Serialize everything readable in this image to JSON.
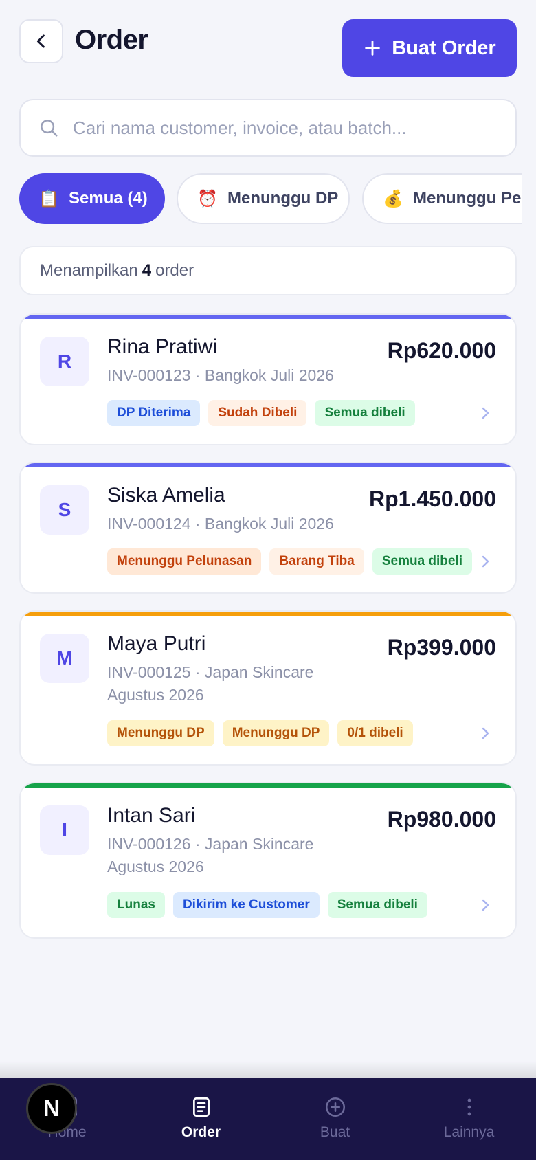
{
  "header": {
    "title": "Order",
    "create_label": "Buat Order"
  },
  "search": {
    "placeholder": "Cari nama customer, invoice, atau batch..."
  },
  "filters": [
    {
      "emoji": "📋",
      "label": "Semua (4)",
      "active": true
    },
    {
      "emoji": "⏰",
      "label": "Menunggu DP",
      "active": false
    },
    {
      "emoji": "💰",
      "label": "Menunggu Pelunasan",
      "active": false
    }
  ],
  "summary": {
    "prefix": "Menampilkan",
    "count": "4",
    "suffix": "order"
  },
  "orders": [
    {
      "initial": "R",
      "name": "Rina Pratiwi",
      "sub_line1": "INV-000123 · Bangkok Juli 2026",
      "sub_line2": "",
      "amount": "Rp620.000",
      "accent": "#6366f1",
      "badges": [
        {
          "label": "DP Diterima",
          "style": "blue"
        },
        {
          "label": "Sudah Dibeli",
          "style": "peach"
        },
        {
          "label": "Semua dibeli",
          "style": "green"
        }
      ]
    },
    {
      "initial": "S",
      "name": "Siska Amelia",
      "sub_line1": "INV-000124 · Bangkok Juli 2026",
      "sub_line2": "",
      "amount": "Rp1.450.000",
      "accent": "#6366f1",
      "badges": [
        {
          "label": "Menunggu Pelunasan",
          "style": "orange"
        },
        {
          "label": "Barang Tiba",
          "style": "peach"
        },
        {
          "label": "Semua dibeli",
          "style": "green"
        }
      ]
    },
    {
      "initial": "M",
      "name": "Maya Putri",
      "sub_line1": "INV-000125 · Japan Skincare",
      "sub_line2": "Agustus 2026",
      "amount": "Rp399.000",
      "accent": "#f59e0b",
      "badges": [
        {
          "label": "Menunggu DP",
          "style": "yellow"
        },
        {
          "label": "Menunggu DP",
          "style": "yellow"
        },
        {
          "label": "0/1 dibeli",
          "style": "yellow"
        }
      ]
    },
    {
      "initial": "I",
      "name": "Intan Sari",
      "sub_line1": "INV-000126 · Japan Skincare",
      "sub_line2": "Agustus 2026",
      "amount": "Rp980.000",
      "accent": "#16a34a",
      "badges": [
        {
          "label": "Lunas",
          "style": "green"
        },
        {
          "label": "Dikirim ke Customer",
          "style": "blue"
        },
        {
          "label": "Semua dibeli",
          "style": "green"
        }
      ]
    }
  ],
  "nav": [
    {
      "label": "Home",
      "icon": "grid-icon",
      "active": false
    },
    {
      "label": "Order",
      "icon": "document-icon",
      "active": true
    },
    {
      "label": "Buat",
      "icon": "plus-circle-icon",
      "active": false
    },
    {
      "label": "Lainnya",
      "icon": "more-vertical-icon",
      "active": false
    }
  ],
  "dev_badge": {
    "letter": "N"
  }
}
